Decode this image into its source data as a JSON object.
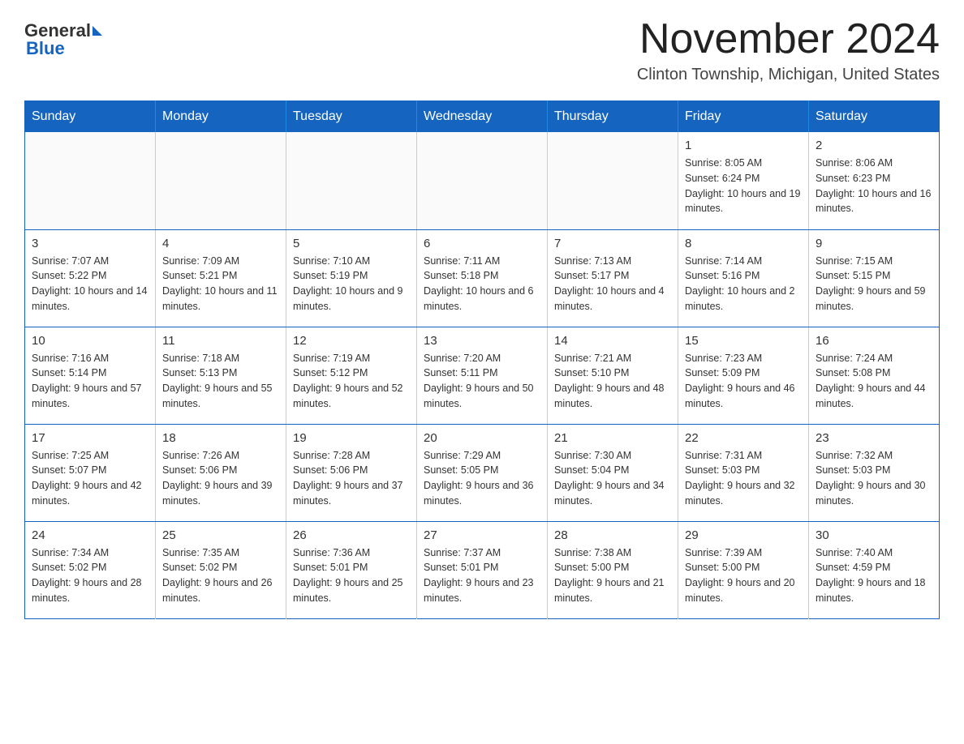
{
  "header": {
    "logo_general": "General",
    "logo_blue": "Blue",
    "month_title": "November 2024",
    "location": "Clinton Township, Michigan, United States"
  },
  "calendar": {
    "days_of_week": [
      "Sunday",
      "Monday",
      "Tuesday",
      "Wednesday",
      "Thursday",
      "Friday",
      "Saturday"
    ],
    "weeks": [
      [
        {
          "day": "",
          "info": ""
        },
        {
          "day": "",
          "info": ""
        },
        {
          "day": "",
          "info": ""
        },
        {
          "day": "",
          "info": ""
        },
        {
          "day": "",
          "info": ""
        },
        {
          "day": "1",
          "info": "Sunrise: 8:05 AM\nSunset: 6:24 PM\nDaylight: 10 hours and 19 minutes."
        },
        {
          "day": "2",
          "info": "Sunrise: 8:06 AM\nSunset: 6:23 PM\nDaylight: 10 hours and 16 minutes."
        }
      ],
      [
        {
          "day": "3",
          "info": "Sunrise: 7:07 AM\nSunset: 5:22 PM\nDaylight: 10 hours and 14 minutes."
        },
        {
          "day": "4",
          "info": "Sunrise: 7:09 AM\nSunset: 5:21 PM\nDaylight: 10 hours and 11 minutes."
        },
        {
          "day": "5",
          "info": "Sunrise: 7:10 AM\nSunset: 5:19 PM\nDaylight: 10 hours and 9 minutes."
        },
        {
          "day": "6",
          "info": "Sunrise: 7:11 AM\nSunset: 5:18 PM\nDaylight: 10 hours and 6 minutes."
        },
        {
          "day": "7",
          "info": "Sunrise: 7:13 AM\nSunset: 5:17 PM\nDaylight: 10 hours and 4 minutes."
        },
        {
          "day": "8",
          "info": "Sunrise: 7:14 AM\nSunset: 5:16 PM\nDaylight: 10 hours and 2 minutes."
        },
        {
          "day": "9",
          "info": "Sunrise: 7:15 AM\nSunset: 5:15 PM\nDaylight: 9 hours and 59 minutes."
        }
      ],
      [
        {
          "day": "10",
          "info": "Sunrise: 7:16 AM\nSunset: 5:14 PM\nDaylight: 9 hours and 57 minutes."
        },
        {
          "day": "11",
          "info": "Sunrise: 7:18 AM\nSunset: 5:13 PM\nDaylight: 9 hours and 55 minutes."
        },
        {
          "day": "12",
          "info": "Sunrise: 7:19 AM\nSunset: 5:12 PM\nDaylight: 9 hours and 52 minutes."
        },
        {
          "day": "13",
          "info": "Sunrise: 7:20 AM\nSunset: 5:11 PM\nDaylight: 9 hours and 50 minutes."
        },
        {
          "day": "14",
          "info": "Sunrise: 7:21 AM\nSunset: 5:10 PM\nDaylight: 9 hours and 48 minutes."
        },
        {
          "day": "15",
          "info": "Sunrise: 7:23 AM\nSunset: 5:09 PM\nDaylight: 9 hours and 46 minutes."
        },
        {
          "day": "16",
          "info": "Sunrise: 7:24 AM\nSunset: 5:08 PM\nDaylight: 9 hours and 44 minutes."
        }
      ],
      [
        {
          "day": "17",
          "info": "Sunrise: 7:25 AM\nSunset: 5:07 PM\nDaylight: 9 hours and 42 minutes."
        },
        {
          "day": "18",
          "info": "Sunrise: 7:26 AM\nSunset: 5:06 PM\nDaylight: 9 hours and 39 minutes."
        },
        {
          "day": "19",
          "info": "Sunrise: 7:28 AM\nSunset: 5:06 PM\nDaylight: 9 hours and 37 minutes."
        },
        {
          "day": "20",
          "info": "Sunrise: 7:29 AM\nSunset: 5:05 PM\nDaylight: 9 hours and 36 minutes."
        },
        {
          "day": "21",
          "info": "Sunrise: 7:30 AM\nSunset: 5:04 PM\nDaylight: 9 hours and 34 minutes."
        },
        {
          "day": "22",
          "info": "Sunrise: 7:31 AM\nSunset: 5:03 PM\nDaylight: 9 hours and 32 minutes."
        },
        {
          "day": "23",
          "info": "Sunrise: 7:32 AM\nSunset: 5:03 PM\nDaylight: 9 hours and 30 minutes."
        }
      ],
      [
        {
          "day": "24",
          "info": "Sunrise: 7:34 AM\nSunset: 5:02 PM\nDaylight: 9 hours and 28 minutes."
        },
        {
          "day": "25",
          "info": "Sunrise: 7:35 AM\nSunset: 5:02 PM\nDaylight: 9 hours and 26 minutes."
        },
        {
          "day": "26",
          "info": "Sunrise: 7:36 AM\nSunset: 5:01 PM\nDaylight: 9 hours and 25 minutes."
        },
        {
          "day": "27",
          "info": "Sunrise: 7:37 AM\nSunset: 5:01 PM\nDaylight: 9 hours and 23 minutes."
        },
        {
          "day": "28",
          "info": "Sunrise: 7:38 AM\nSunset: 5:00 PM\nDaylight: 9 hours and 21 minutes."
        },
        {
          "day": "29",
          "info": "Sunrise: 7:39 AM\nSunset: 5:00 PM\nDaylight: 9 hours and 20 minutes."
        },
        {
          "day": "30",
          "info": "Sunrise: 7:40 AM\nSunset: 4:59 PM\nDaylight: 9 hours and 18 minutes."
        }
      ]
    ]
  }
}
